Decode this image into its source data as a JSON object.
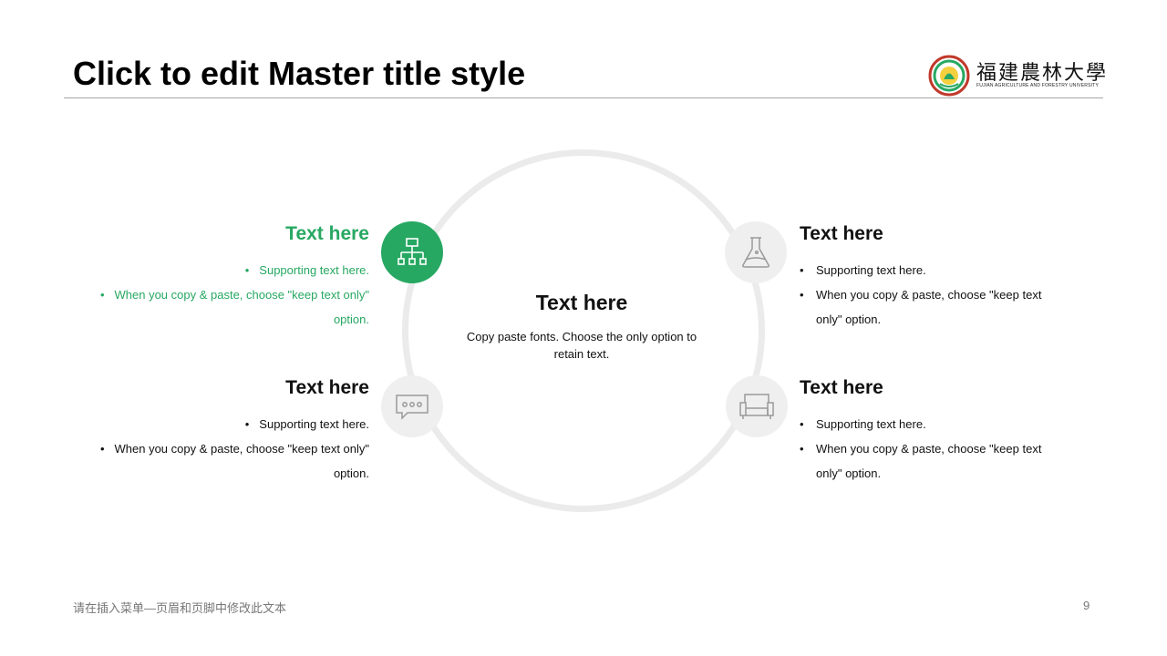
{
  "slide": {
    "title": "Click to edit Master title style",
    "logo": {
      "name": "福建農林大學",
      "subtitle": "FUJIAN AGRICULTURE AND FORESTRY UNIVERSITY"
    },
    "center": {
      "heading": "Text here",
      "body": "Copy paste fonts. Choose the only option to retain text."
    },
    "blocks": [
      {
        "icon": "org-chart-icon",
        "heading": "Text here",
        "bullets": [
          "Supporting text here.",
          "When you copy & paste, choose \"keep text only\" option."
        ]
      },
      {
        "icon": "flask-icon",
        "heading": "Text here",
        "bullets": [
          "Supporting text here.",
          "When you copy & paste, choose \"keep text only\" option."
        ]
      },
      {
        "icon": "chat-bubble-icon",
        "heading": "Text here",
        "bullets": [
          "Supporting text here.",
          "When you copy & paste, choose \"keep text only\" option."
        ]
      },
      {
        "icon": "sofa-icon",
        "heading": "Text here",
        "bullets": [
          "Supporting text here.",
          "When you copy & paste, choose \"keep text only\" option."
        ]
      }
    ],
    "footer": "请在插入菜单—页眉和页脚中修改此文本",
    "page_number": "9"
  },
  "colors": {
    "accent": "#27a862",
    "ring": "#ebebeb",
    "icon_bg": "#efefef",
    "icon_stroke": "#9a9a9a",
    "rule": "#a6a6a6"
  }
}
